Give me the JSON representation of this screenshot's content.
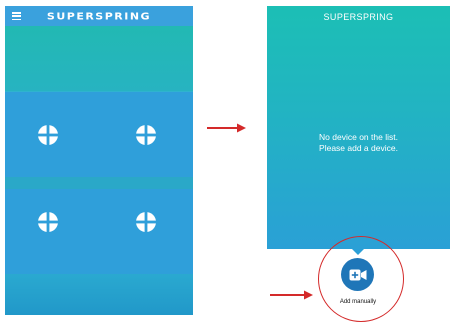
{
  "left_screen": {
    "title": "SUPERSPRING",
    "grid_slots": [
      {
        "icon": "add-circle-icon"
      },
      {
        "icon": "add-circle-icon"
      },
      {
        "icon": "add-circle-icon"
      },
      {
        "icon": "add-circle-icon"
      }
    ],
    "menu_icon": "hamburger-icon"
  },
  "right_screen": {
    "title": "SUPERSPRING",
    "empty_message_line1": "No device on the list.",
    "empty_message_line2": "Please add a device."
  },
  "add_manually": {
    "label": "Add manually",
    "icon": "video-camera-plus-icon"
  },
  "colors": {
    "header_blue": "#3aa1dd",
    "teal": "#22b9b3",
    "cell_blue": "#2f9fda",
    "button_blue": "#1f76b8",
    "annotation_red": "#d42a2a"
  }
}
